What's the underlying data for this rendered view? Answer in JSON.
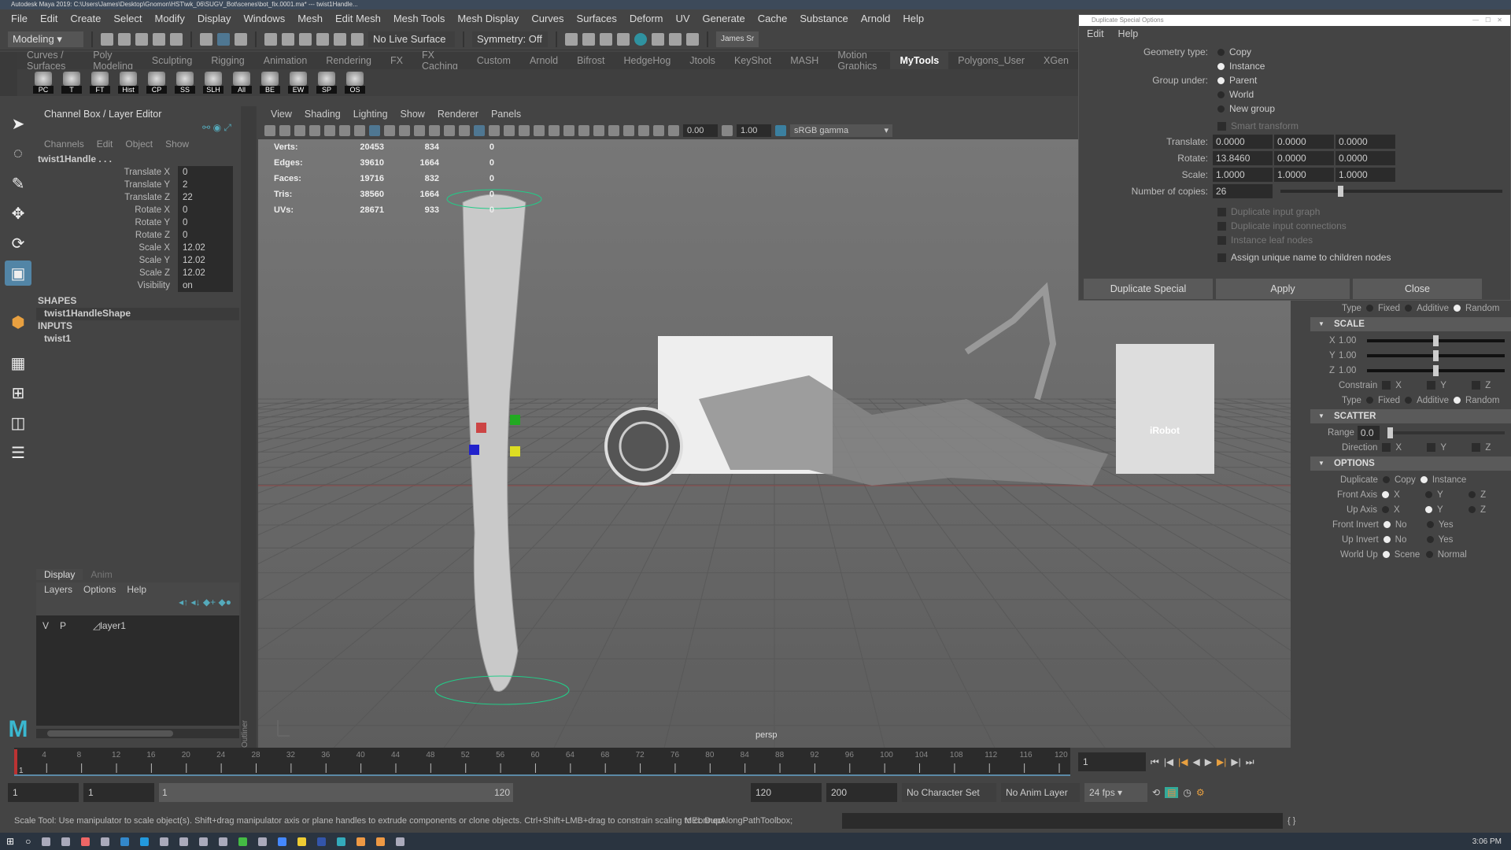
{
  "window": {
    "title": "Autodesk Maya 2019: C:\\Users\\James\\Desktop\\Gnomon\\HST\\wk_06\\SUGV_Bot\\scenes\\bot_fix.0001.ma* --- twist1Handle..."
  },
  "menubar": [
    "File",
    "Edit",
    "Create",
    "Select",
    "Modify",
    "Display",
    "Windows",
    "Mesh",
    "Edit Mesh",
    "Mesh Tools",
    "Mesh Display",
    "Curves",
    "Surfaces",
    "Deform",
    "UV",
    "Generate",
    "Cache",
    "Substance",
    "Arnold",
    "Help"
  ],
  "statusline": {
    "mode": "Modeling",
    "live_surface": "No Live Surface",
    "symmetry": "Symmetry: Off",
    "user": "James Sr"
  },
  "shelf": {
    "tabs": [
      "Curves / Surfaces",
      "Poly Modeling",
      "Sculpting",
      "Rigging",
      "Animation",
      "Rendering",
      "FX",
      "FX Caching",
      "Custom",
      "Arnold",
      "Bifrost",
      "HedgeHog",
      "Jtools",
      "KeyShot",
      "MASH",
      "Motion Graphics",
      "MyTools",
      "Polygons_User",
      "XGen"
    ],
    "active": "MyTools",
    "buttons": [
      "PC",
      "T",
      "FT",
      "Hist",
      "CP",
      "SS",
      "SLH",
      "All",
      "BE",
      "EW",
      "SP",
      "OS"
    ]
  },
  "channelbox": {
    "title": "Channel Box / Layer Editor",
    "menu": [
      "Channels",
      "Edit",
      "Object",
      "Show"
    ],
    "object": "twist1Handle . . .",
    "channels": [
      {
        "name": "Translate X",
        "value": "0"
      },
      {
        "name": "Translate Y",
        "value": "2"
      },
      {
        "name": "Translate Z",
        "value": "22"
      },
      {
        "name": "Rotate X",
        "value": "0"
      },
      {
        "name": "Rotate Y",
        "value": "0"
      },
      {
        "name": "Rotate Z",
        "value": "0"
      },
      {
        "name": "Scale X",
        "value": "12.02"
      },
      {
        "name": "Scale Y",
        "value": "12.02"
      },
      {
        "name": "Scale Z",
        "value": "12.02"
      },
      {
        "name": "Visibility",
        "value": "on"
      }
    ],
    "shapes_label": "SHAPES",
    "shape": "twist1HandleShape",
    "inputs_label": "INPUTS",
    "input": "twist1"
  },
  "layereditor": {
    "tabs": [
      "Display",
      "Anim"
    ],
    "menu": [
      "Layers",
      "Options",
      "Help"
    ],
    "layer": {
      "v": "V",
      "p": "P",
      "name": "layer1"
    }
  },
  "outliner_label": "Outliner",
  "viewport": {
    "menu": [
      "View",
      "Shading",
      "Lighting",
      "Show",
      "Renderer",
      "Panels"
    ],
    "exposure": "0.00",
    "gamma": "1.00",
    "colorspace": "sRGB gamma",
    "camera": "persp",
    "hud": [
      {
        "label": "Verts:",
        "a": "20453",
        "b": "834",
        "c": "0"
      },
      {
        "label": "Edges:",
        "a": "39610",
        "b": "1664",
        "c": "0"
      },
      {
        "label": "Faces:",
        "a": "19716",
        "b": "832",
        "c": "0"
      },
      {
        "label": "Tris:",
        "a": "38560",
        "b": "1664",
        "c": "0"
      },
      {
        "label": "UVs:",
        "a": "28671",
        "b": "933",
        "c": "0"
      }
    ],
    "poster_text": "iRobot"
  },
  "dialog": {
    "title": "Duplicate Special Options",
    "menu": [
      "Edit",
      "Help"
    ],
    "geometry_type_label": "Geometry type:",
    "geometry_type": [
      "Copy",
      "Instance"
    ],
    "geometry_selected": "Instance",
    "group_under_label": "Group under:",
    "group_under": [
      "Parent",
      "World",
      "New group"
    ],
    "group_selected": "Parent",
    "smart_transform": "Smart transform",
    "translate_label": "Translate:",
    "translate": [
      "0.0000",
      "0.0000",
      "0.0000"
    ],
    "rotate_label": "Rotate:",
    "rotate": [
      "13.8460",
      "0.0000",
      "0.0000"
    ],
    "scale_label": "Scale:",
    "scale": [
      "1.0000",
      "1.0000",
      "1.0000"
    ],
    "copies_label": "Number of copies:",
    "copies": "26",
    "copies_slider_fraction": 0.26,
    "options": [
      "Duplicate input graph",
      "Duplicate input connections",
      "Instance leaf nodes"
    ],
    "assign_unique": "Assign unique name to children nodes",
    "buttons": {
      "duplicate": "Duplicate Special",
      "apply": "Apply",
      "close": "Close"
    }
  },
  "rightpanel": {
    "type_label": "Type",
    "type_options": [
      "Fixed",
      "Additive",
      "Random"
    ],
    "type_selected": "Random",
    "scale_section": "SCALE",
    "scale": [
      {
        "axis": "X",
        "value": "1.00"
      },
      {
        "axis": "Y",
        "value": "1.00"
      },
      {
        "axis": "Z",
        "value": "1.00"
      }
    ],
    "constrain_label": "Constrain",
    "axes": [
      "X",
      "Y",
      "Z"
    ],
    "scatter_section": "SCATTER",
    "range_label": "Range",
    "range": "0.0",
    "direction_label": "Direction",
    "options_section": "OPTIONS",
    "duplicate_label": "Duplicate",
    "duplicate_options": [
      "Copy",
      "Instance"
    ],
    "front_axis_label": "Front Axis",
    "up_axis_label": "Up Axis",
    "front_invert_label": "Front Invert",
    "up_invert_label": "Up Invert",
    "no": "No",
    "yes": "Yes",
    "world_up_label": "World Up",
    "world_up_options": [
      "Scene",
      "Normal"
    ]
  },
  "timeline": {
    "ticks": [
      "4",
      "8",
      "12",
      "16",
      "20",
      "24",
      "28",
      "32",
      "36",
      "40",
      "44",
      "48",
      "52",
      "56",
      "60",
      "64",
      "68",
      "72",
      "76",
      "80",
      "84",
      "88",
      "92",
      "96",
      "100",
      "104",
      "108",
      "112",
      "116",
      "120"
    ],
    "current_frame": "1",
    "start_marker": "1"
  },
  "range": {
    "start": "1",
    "playback_start": "1",
    "slider_start": "1",
    "slider_end": "120",
    "playback_end": "120",
    "end": "200",
    "character_set": "No Character Set",
    "anim_layer": "No Anim Layer",
    "fps": "24 fps"
  },
  "helpline": {
    "text": "Scale Tool: Use manipulator to scale object(s). Shift+drag manipulator axis or plane handles to extrude components or clone objects. Ctrl+Shift+LMB+drag to constrain scaling to connect",
    "mel_label": "MEL",
    "command": "DupAlongPathToolbox;"
  },
  "taskbar": {
    "clock": "3:06 PM"
  }
}
